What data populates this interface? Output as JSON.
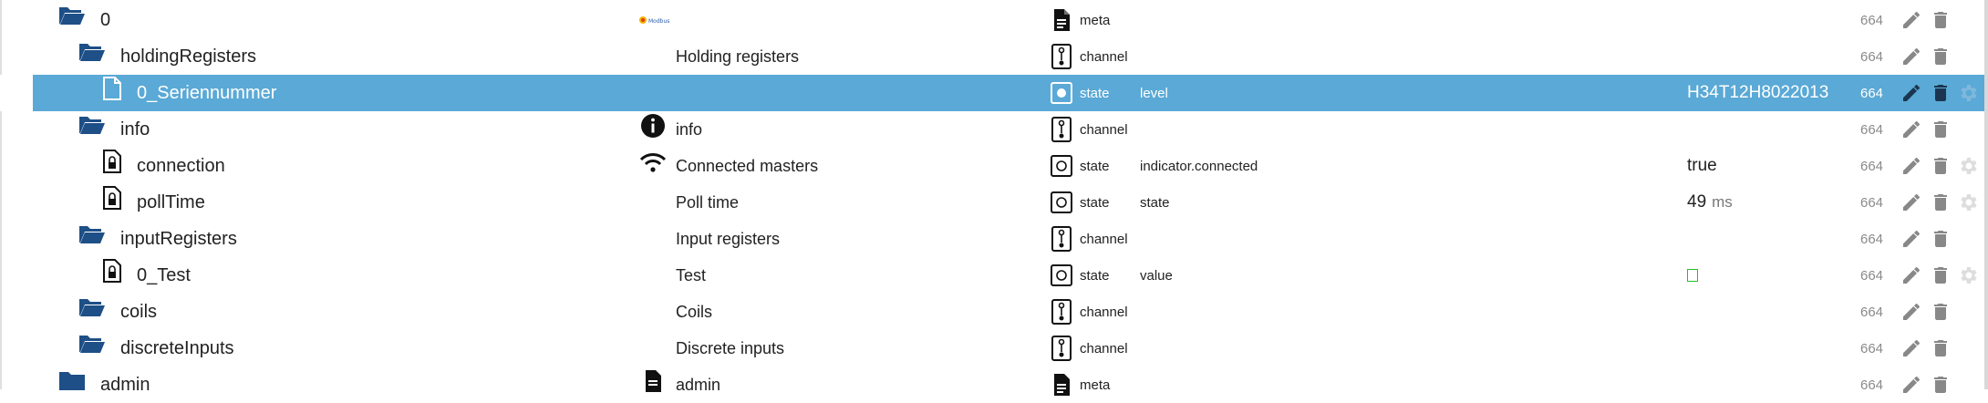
{
  "colors": {
    "folder": "#1e4f86",
    "selected_bg": "#5aa9d6",
    "action_icon": "#888888",
    "value_box": "#22c322"
  },
  "rows": [
    {
      "name": "0",
      "desc": "",
      "desc_icon": "modbus-logo",
      "type": "meta",
      "type_icon": "document-icon",
      "role": "",
      "value": "",
      "unit": "",
      "acl": "664",
      "tree_icon": "folder-open-icon"
    },
    {
      "name": "holdingRegisters",
      "desc": "Holding registers",
      "type": "channel",
      "type_icon": "channel-icon",
      "role": "",
      "value": "",
      "unit": "",
      "acl": "664",
      "tree_icon": "folder-open-icon"
    },
    {
      "name": "0_Seriennummer",
      "desc": "",
      "type": "state",
      "type_icon": "state-icon",
      "role": "level",
      "value": "H34T12H8022013",
      "unit": "",
      "acl": "664",
      "tree_icon": "file-icon",
      "selected": true
    },
    {
      "name": "info",
      "desc": "info",
      "desc_icon": "info-icon",
      "type": "channel",
      "type_icon": "channel-icon",
      "role": "",
      "value": "",
      "unit": "",
      "acl": "664",
      "tree_icon": "folder-open-icon"
    },
    {
      "name": "connection",
      "desc": "Connected masters",
      "desc_icon": "wifi-icon",
      "type": "state",
      "type_icon": "state-icon",
      "role": "indicator.connected",
      "value": "true",
      "unit": "",
      "acl": "664",
      "tree_icon": "locked-file-icon"
    },
    {
      "name": "pollTime",
      "desc": "Poll time",
      "type": "state",
      "type_icon": "state-icon",
      "role": "state",
      "value": "49",
      "unit": "ms",
      "acl": "664",
      "tree_icon": "locked-file-icon"
    },
    {
      "name": "inputRegisters",
      "desc": "Input registers",
      "type": "channel",
      "type_icon": "channel-icon",
      "role": "",
      "value": "",
      "unit": "",
      "acl": "664",
      "tree_icon": "folder-open-icon"
    },
    {
      "name": "0_Test",
      "desc": "Test",
      "type": "state",
      "type_icon": "state-icon",
      "role": "value",
      "value": "",
      "unit": "",
      "acl": "664",
      "tree_icon": "locked-file-icon"
    },
    {
      "name": "coils",
      "desc": "Coils",
      "type": "channel",
      "type_icon": "channel-icon",
      "role": "",
      "value": "",
      "unit": "",
      "acl": "664",
      "tree_icon": "folder-open-icon"
    },
    {
      "name": "discreteInputs",
      "desc": "Discrete inputs",
      "type": "channel",
      "type_icon": "channel-icon",
      "role": "",
      "value": "",
      "unit": "",
      "acl": "664",
      "tree_icon": "folder-open-icon"
    },
    {
      "name": "admin",
      "desc": "admin",
      "desc_icon": "document-icon",
      "type": "meta",
      "type_icon": "document-icon",
      "role": "",
      "value": "",
      "unit": "",
      "acl": "664",
      "tree_icon": "folder-closed-icon"
    }
  ],
  "modbus_logo_text": "Modbus"
}
